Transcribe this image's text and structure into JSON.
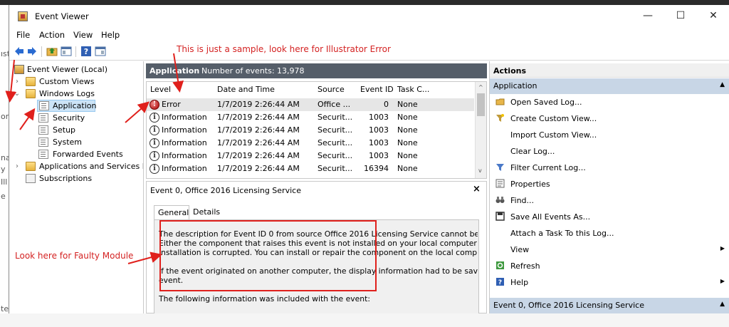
{
  "window": {
    "title": "Event Viewer",
    "minimize_glyph": "—",
    "maximize_glyph": "☐",
    "close_glyph": "✕"
  },
  "menu": [
    "File",
    "Action",
    "View",
    "Help"
  ],
  "left_strip_chars": [
    "ıst",
    "or",
    "na",
    "y",
    "Ill",
    "e",
    "te"
  ],
  "tree": {
    "items": [
      {
        "label": "Event Viewer (Local)",
        "icon": "event-viewer-icon"
      },
      {
        "label": "Custom Views",
        "icon": "folder-icon"
      },
      {
        "label": "Windows Logs",
        "icon": "folder-icon"
      },
      {
        "label": "Application",
        "icon": "log-icon"
      },
      {
        "label": "Security",
        "icon": "log-icon"
      },
      {
        "label": "Setup",
        "icon": "log-icon"
      },
      {
        "label": "System",
        "icon": "log-icon"
      },
      {
        "label": "Forwarded Events",
        "icon": "log-icon"
      },
      {
        "label": "Applications and Services Lo",
        "icon": "folder-icon"
      },
      {
        "label": "Subscriptions",
        "icon": "subscriptions-icon"
      }
    ]
  },
  "center": {
    "header_title": "Application",
    "header_count": "Number of events: 13,978",
    "columns": [
      "Level",
      "Date and Time",
      "Source",
      "Event ID",
      "Task C..."
    ],
    "rows": [
      {
        "level": "Error",
        "date": "1/7/2019 2:26:44 AM",
        "source": "Office ...",
        "event_id": "0",
        "task": "None"
      },
      {
        "level": "Information",
        "date": "1/7/2019 2:26:44 AM",
        "source": "Securit...",
        "event_id": "1003",
        "task": "None"
      },
      {
        "level": "Information",
        "date": "1/7/2019 2:26:44 AM",
        "source": "Securit...",
        "event_id": "1003",
        "task": "None"
      },
      {
        "level": "Information",
        "date": "1/7/2019 2:26:44 AM",
        "source": "Securit...",
        "event_id": "1003",
        "task": "None"
      },
      {
        "level": "Information",
        "date": "1/7/2019 2:26:44 AM",
        "source": "Securit...",
        "event_id": "1003",
        "task": "None"
      },
      {
        "level": "Information",
        "date": "1/7/2019 2:26:44 AM",
        "source": "Securit...",
        "event_id": "16394",
        "task": "None"
      }
    ],
    "detail": {
      "title": "Event 0, Office 2016 Licensing Service",
      "close": "×",
      "tabs": [
        "General",
        "Details"
      ],
      "lines": [
        "The description for Event ID 0 from source Office 2016 Licensing Service cannot be found",
        "Either the component that raises this event is not installed on your local computer or the",
        "installation is corrupted. You can install or repair the component on the local computer.",
        "",
        "If the event originated on another computer, the display information had to be saved wit",
        "event.",
        "",
        "The following information was included with the event:"
      ]
    }
  },
  "actions": {
    "header": "Actions",
    "section1": "Application",
    "items": [
      {
        "label": "Open Saved Log...",
        "icon": "open-folder-icon"
      },
      {
        "label": "Create Custom View...",
        "icon": "filter-star-icon"
      },
      {
        "label": "Import Custom View...",
        "icon": ""
      },
      {
        "label": "Clear Log...",
        "icon": ""
      },
      {
        "label": "Filter Current Log...",
        "icon": "filter-icon"
      },
      {
        "label": "Properties",
        "icon": "properties-icon"
      },
      {
        "label": "Find...",
        "icon": "binoculars-icon"
      },
      {
        "label": "Save All Events As...",
        "icon": "save-icon"
      },
      {
        "label": "Attach a Task To this Log...",
        "icon": ""
      },
      {
        "label": "View",
        "icon": "",
        "submenu": true
      },
      {
        "label": "Refresh",
        "icon": "refresh-icon"
      },
      {
        "label": "Help",
        "icon": "help-icon",
        "submenu": true
      }
    ],
    "section2": "Event 0, Office 2016 Licensing Service"
  },
  "annotations": {
    "top_note": "This is just a sample, look here for Illustrator Error",
    "left_note": "Look here for Faulty Module",
    "color": "#d42222"
  }
}
